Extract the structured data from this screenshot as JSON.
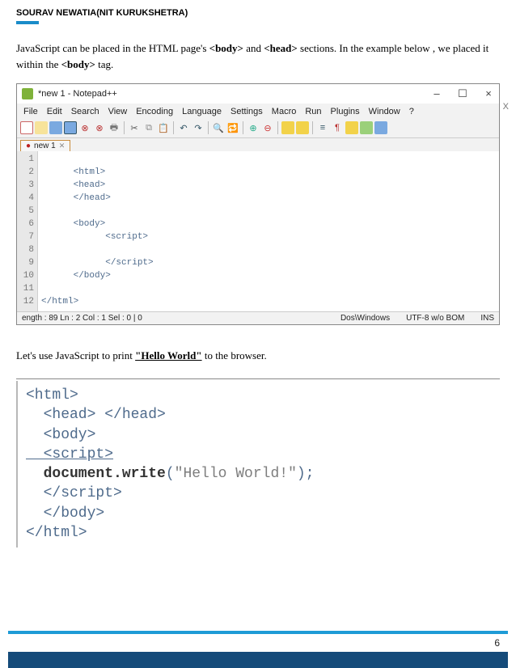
{
  "doc": {
    "header": "SOURAV NEWATIA(NIT KURUKSHETRA)",
    "intro_pre": "JavaScript can be placed in the HTML page's ",
    "intro_body": "<body>",
    "intro_and": " and ",
    "intro_head": "<head>",
    "intro_post": " sections. In the example below , we placed it within the ",
    "intro_bodytag": "<body>",
    "intro_end": " tag.",
    "mid_pre": "Let's use JavaScript to print ",
    "mid_hw": "\"Hello World\"",
    "mid_post": " to the browser.",
    "page_number": "6"
  },
  "notepadpp": {
    "title": "*new 1 - Notepad++",
    "window_controls": {
      "minimize": "–",
      "maximize": "☐",
      "close": "×"
    },
    "extra_x": "X",
    "menu": [
      "File",
      "Edit",
      "Search",
      "View",
      "Encoding",
      "Language",
      "Settings",
      "Macro",
      "Run",
      "Plugins",
      "Window",
      "?"
    ],
    "tab_label": "new 1",
    "tab_close": "✕",
    "line_numbers": [
      "1",
      "2",
      "3",
      "4",
      "5",
      "6",
      "7",
      "8",
      "9",
      "10",
      "11",
      "12"
    ],
    "code": [
      "<html>",
      "",
      "      <head>",
      "      </head>",
      "",
      "      <body>",
      "            <script>",
      "",
      "            </script>",
      "      </body>",
      "",
      "</html>"
    ],
    "status": {
      "left": "ength : 89   Ln : 2   Col : 1   Sel : 0 | 0",
      "os": "Dos\\Windows",
      "enc": "UTF-8 w/o BOM",
      "mode": "INS"
    }
  },
  "code2": {
    "l1": "<html>",
    "l2": "  <head> </head>",
    "l3": "  <body>",
    "l4": "  <script>",
    "l5a": "  document.write",
    "l5b": "(",
    "l5c": "\"Hello World!\"",
    "l5d": ");",
    "l6": "  </script>",
    "l7": "  </body>",
    "l8": "</html>"
  }
}
